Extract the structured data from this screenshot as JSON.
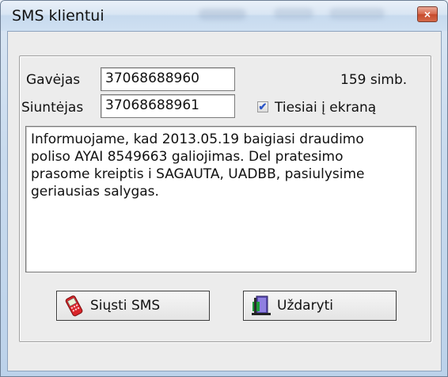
{
  "window": {
    "title": "SMS klientui",
    "close_glyph": "×"
  },
  "form": {
    "recipient_label": "Gavėjas",
    "recipient_value": "37068688960",
    "char_count": "159 simb.",
    "sender_label": "Siuntėjas",
    "sender_value": "37068688961",
    "direct_checkbox_label": "Tiesiai į ekraną",
    "direct_checkbox_checked": true,
    "message": "Informuojame, kad 2013.05.19 baigiasi draudimo\npoliso AYAI 8549663 galiojimas. Del pratesimo\nprasome kreiptis i SAGAUTA, UADBB, pasiulysime\ngeriausias salygas."
  },
  "buttons": {
    "send_label": "Siųsti SMS",
    "send_icon": "mobile-phone-icon",
    "close_label": "Uždaryti",
    "close_icon": "exit-door-icon"
  },
  "colors": {
    "checkmark": "#2b55c7",
    "close_button": "#c64a2c"
  }
}
